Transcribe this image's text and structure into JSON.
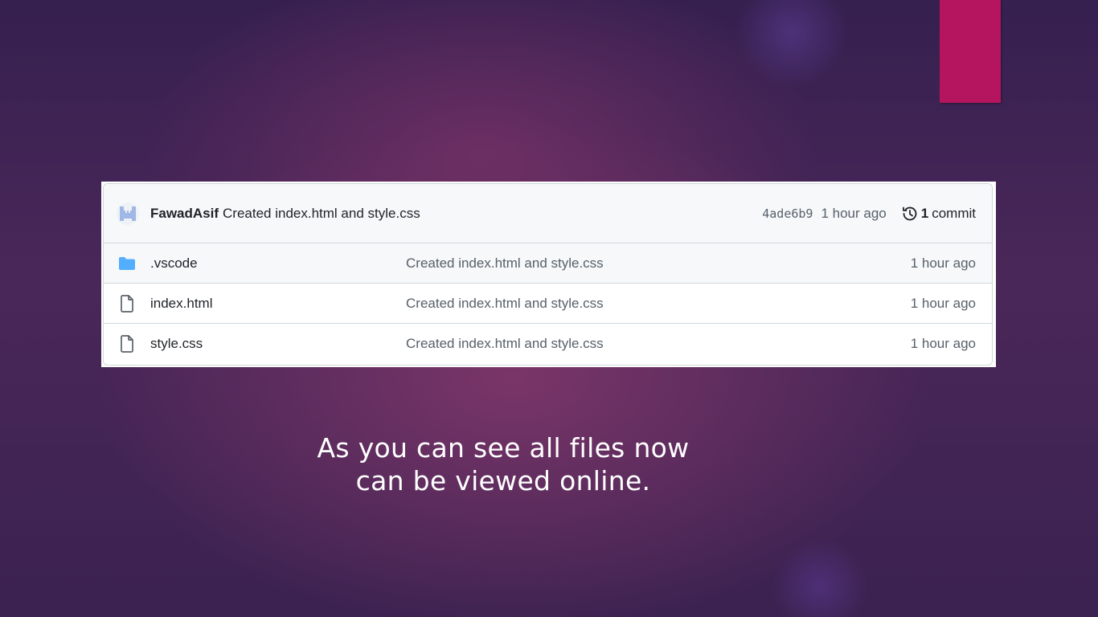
{
  "colors": {
    "accent_bar": "#b5155f",
    "folder_icon": "#54aeff",
    "text_primary": "#1f2328",
    "text_muted": "#57606a"
  },
  "commit": {
    "author": "FawadAsif",
    "message": "Created index.html and style.css",
    "sha": "4ade6b9",
    "time": "1 hour ago",
    "history_icon": "history-icon",
    "count": "1",
    "count_label": "commit"
  },
  "files": [
    {
      "icon": "folder-icon",
      "name": ".vscode",
      "commit": "Created index.html and style.css",
      "time": "1 hour ago"
    },
    {
      "icon": "file-icon",
      "name": "index.html",
      "commit": "Created index.html and style.css",
      "time": "1 hour ago"
    },
    {
      "icon": "file-icon",
      "name": "style.css",
      "commit": "Created index.html and style.css",
      "time": "1 hour ago"
    }
  ],
  "caption": {
    "line1": "As you can see all files now",
    "line2": "can be viewed online."
  }
}
